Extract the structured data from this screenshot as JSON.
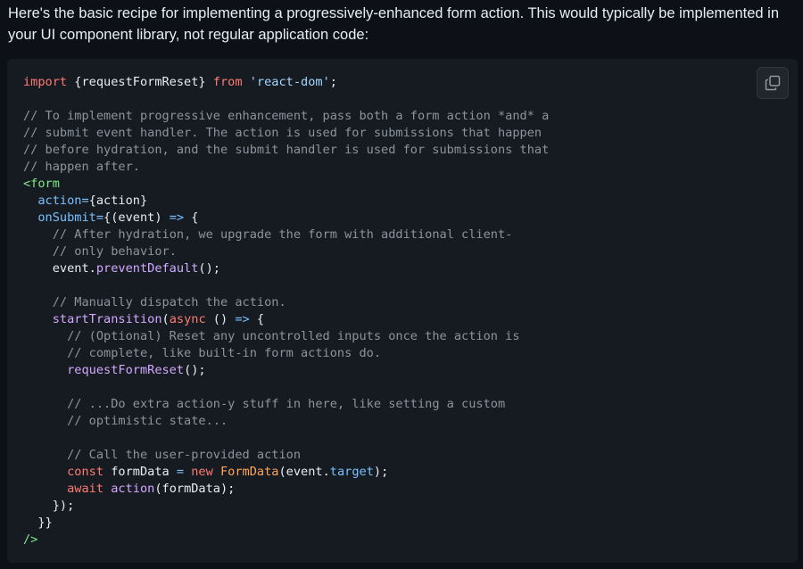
{
  "intro": {
    "text": "Here's the basic recipe for implementing a progressively-enhanced form action. This would typically be implemented in your UI component library, not regular application code:"
  },
  "copy_button": {
    "icon": "copy-icon"
  },
  "colors": {
    "background": "#0d1117",
    "code_background": "#161b22",
    "keyword": "#ff7b72",
    "string": "#a5d6ff",
    "comment": "#8b949e",
    "tag": "#7ee787",
    "attribute": "#79c0ff",
    "function": "#d2a8ff",
    "class": "#ffa657",
    "text": "#e6edf3"
  },
  "code": {
    "language": "jsx",
    "lines": [
      [
        [
          "kw",
          "import"
        ],
        [
          "txt",
          " {requestFormReset} "
        ],
        [
          "kw",
          "from"
        ],
        [
          "txt",
          " "
        ],
        [
          "str",
          "'react-dom'"
        ],
        [
          "txt",
          ";"
        ]
      ],
      [],
      [
        [
          "com",
          "// To implement progressive enhancement, pass both a form action *and* a"
        ]
      ],
      [
        [
          "com",
          "// submit event handler. The action is used for submissions that happen"
        ]
      ],
      [
        [
          "com",
          "// before hydration, and the submit handler is used for submissions that"
        ]
      ],
      [
        [
          "com",
          "// happen after."
        ]
      ],
      [
        [
          "tag",
          "<form"
        ]
      ],
      [
        [
          "txt",
          "  "
        ],
        [
          "attr",
          "action"
        ],
        [
          "op",
          "="
        ],
        [
          "txt",
          "{action}"
        ]
      ],
      [
        [
          "txt",
          "  "
        ],
        [
          "attr",
          "onSubmit"
        ],
        [
          "op",
          "="
        ],
        [
          "txt",
          "{(event) "
        ],
        [
          "op",
          "=>"
        ],
        [
          "txt",
          " {"
        ]
      ],
      [
        [
          "txt",
          "    "
        ],
        [
          "com",
          "// After hydration, we upgrade the form with additional client-"
        ]
      ],
      [
        [
          "txt",
          "    "
        ],
        [
          "com",
          "// only behavior."
        ]
      ],
      [
        [
          "txt",
          "    event."
        ],
        [
          "fn",
          "preventDefault"
        ],
        [
          "txt",
          "();"
        ]
      ],
      [],
      [
        [
          "txt",
          "    "
        ],
        [
          "com",
          "// Manually dispatch the action."
        ]
      ],
      [
        [
          "txt",
          "    "
        ],
        [
          "fn",
          "startTransition"
        ],
        [
          "txt",
          "("
        ],
        [
          "kw",
          "async"
        ],
        [
          "txt",
          " () "
        ],
        [
          "op",
          "=>"
        ],
        [
          "txt",
          " {"
        ]
      ],
      [
        [
          "txt",
          "      "
        ],
        [
          "com",
          "// (Optional) Reset any uncontrolled inputs once the action is"
        ]
      ],
      [
        [
          "txt",
          "      "
        ],
        [
          "com",
          "// complete, like built-in form actions do."
        ]
      ],
      [
        [
          "txt",
          "      "
        ],
        [
          "fn",
          "requestFormReset"
        ],
        [
          "txt",
          "();"
        ]
      ],
      [],
      [
        [
          "txt",
          "      "
        ],
        [
          "com",
          "// ...Do extra action-y stuff in here, like setting a custom"
        ]
      ],
      [
        [
          "txt",
          "      "
        ],
        [
          "com",
          "// optimistic state..."
        ]
      ],
      [],
      [
        [
          "txt",
          "      "
        ],
        [
          "com",
          "// Call the user-provided action"
        ]
      ],
      [
        [
          "txt",
          "      "
        ],
        [
          "kw",
          "const"
        ],
        [
          "txt",
          " formData "
        ],
        [
          "op",
          "="
        ],
        [
          "txt",
          " "
        ],
        [
          "kw",
          "new"
        ],
        [
          "txt",
          " "
        ],
        [
          "cls",
          "FormData"
        ],
        [
          "txt",
          "(event."
        ],
        [
          "attr",
          "target"
        ],
        [
          "txt",
          ");"
        ]
      ],
      [
        [
          "txt",
          "      "
        ],
        [
          "kw",
          "await"
        ],
        [
          "txt",
          " "
        ],
        [
          "fn",
          "action"
        ],
        [
          "txt",
          "(formData);"
        ]
      ],
      [
        [
          "txt",
          "    });"
        ]
      ],
      [
        [
          "txt",
          "  }}"
        ]
      ],
      [
        [
          "tag",
          "/>"
        ]
      ]
    ]
  }
}
